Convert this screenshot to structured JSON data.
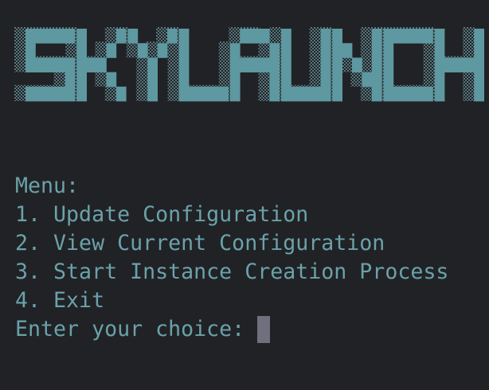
{
  "banner": {
    "text": "SKYLAUNCH",
    "icon": "ascii-block-logo"
  },
  "menu": {
    "title": "Menu:",
    "items": [
      "1. Update Configuration",
      "2. View Current Configuration",
      "3. Start Instance Creation Process",
      "4. Exit"
    ]
  },
  "prompt": {
    "text": "Enter your choice: "
  },
  "colors": {
    "background": "#212226",
    "text": "#6aa2a9",
    "banner_face": "#5e98a1",
    "banner_shade": "#4d6d73",
    "cursor": "#6f6f7d"
  }
}
